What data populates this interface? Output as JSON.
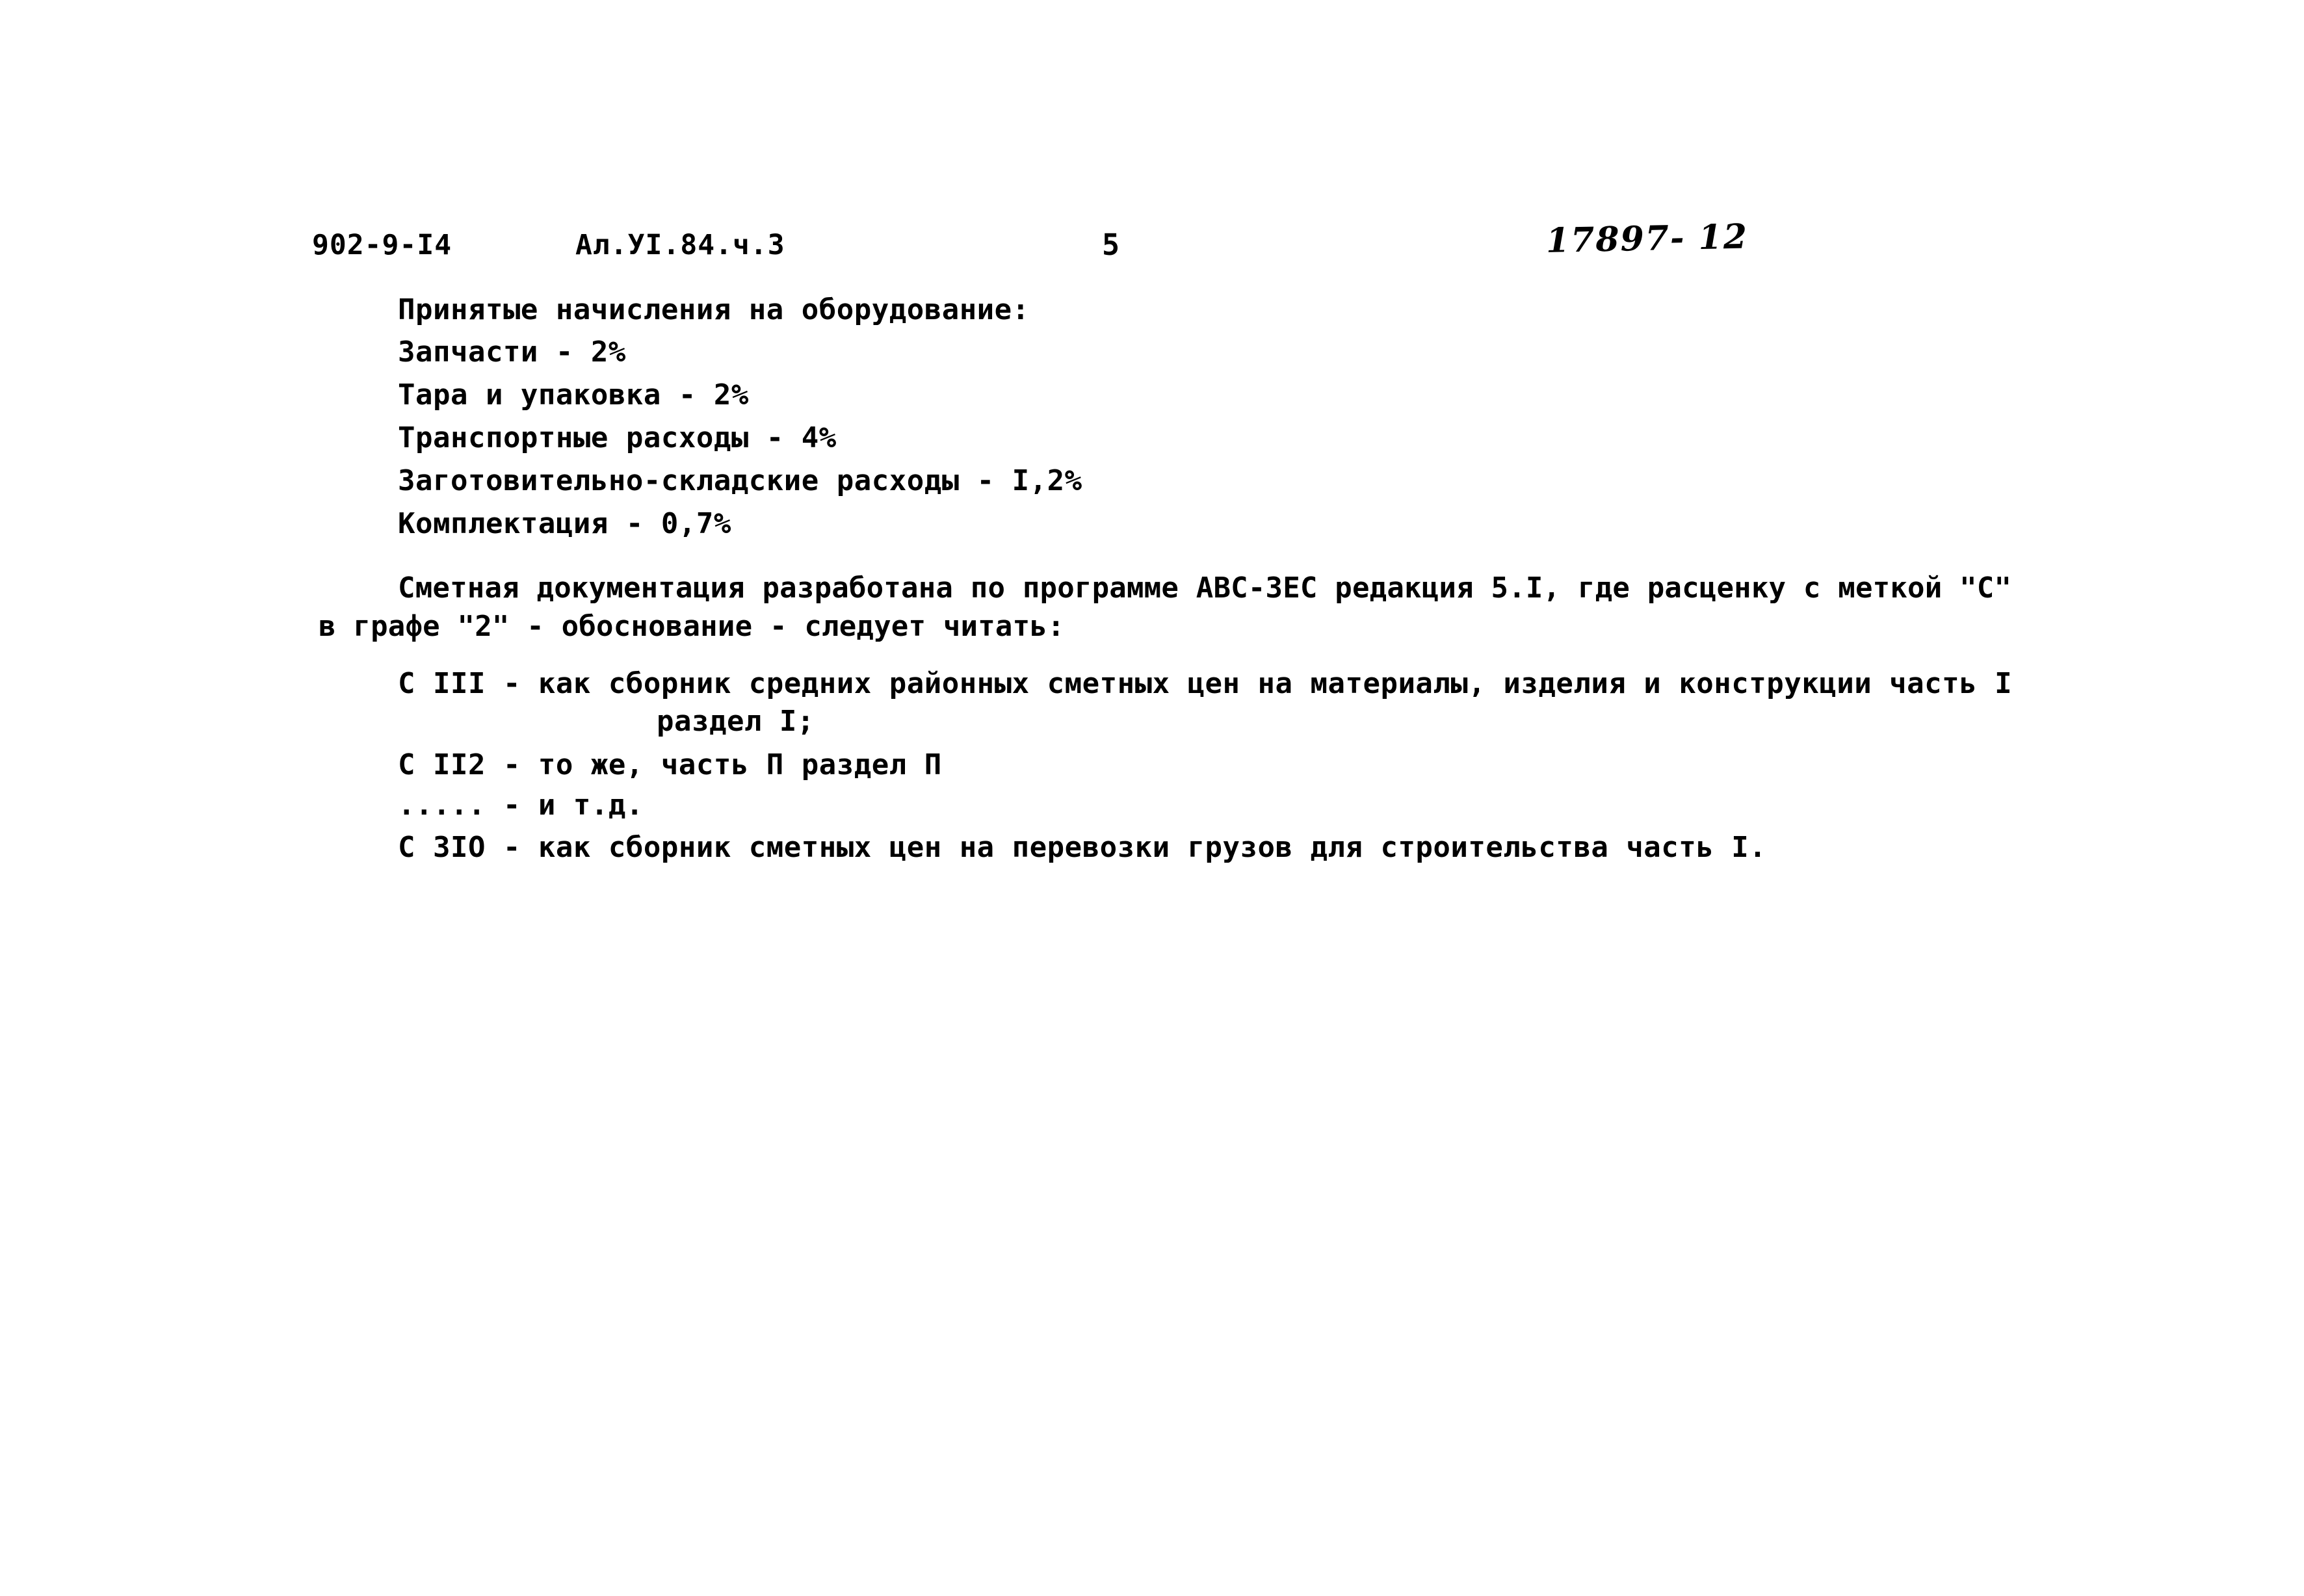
{
  "document": {
    "header": {
      "drawing_code": "902-9-I4",
      "album_ref": "Ал.УI.84.ч.3",
      "page_number": "5",
      "archive_number": "17897- 12"
    },
    "charges_heading": "Принятые начисления на оборудование:",
    "charges": [
      "Запчасти - 2%",
      "Тара и упаковка - 2%",
      "Транспортные расходы - 4%",
      "Заготовительно-складские расходы - I,2%",
      "Комплектация - 0,7%"
    ],
    "paragraph": {
      "line_1": "Сметная документация разработана по программе АВС-ЗЕС редакция 5.I, где расценку с меткой \"С\"",
      "line_2": "в графе \"2\" - обоснование - следует читать:"
    },
    "codes": [
      {
        "line_1": "С III - как сборник средних районных сметных цен на материалы, изделия и конструкции часть I",
        "line_2": "раздел I;"
      },
      {
        "line_1": "С II2 - то же, часть П раздел П",
        "line_2": ""
      },
      {
        "line_1": "..... - и т.д.",
        "line_2": ""
      },
      {
        "line_1": "С 3IO - как сборник сметных цен на перевозки грузов для строительства часть I.",
        "line_2": ""
      }
    ]
  }
}
